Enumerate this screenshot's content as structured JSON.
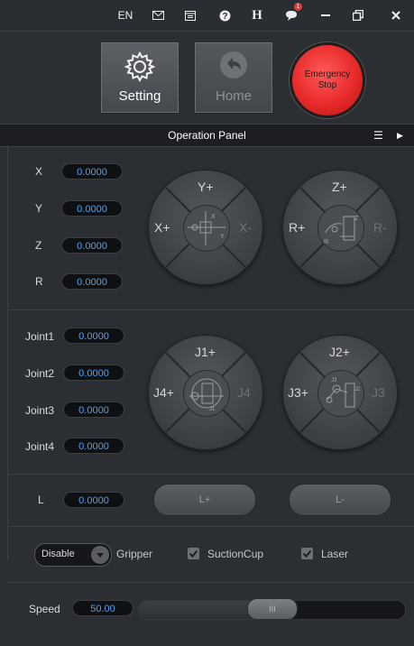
{
  "topbar": {
    "language": "EN",
    "icons": [
      "mail-icon",
      "calendar-icon",
      "help-icon",
      "h-icon",
      "notification-icon",
      "minimize-icon",
      "restore-icon",
      "close-icon"
    ],
    "notification_count": "1",
    "h_label": "H"
  },
  "actions": {
    "setting_label": "Setting",
    "home_label": "Home",
    "emergency_line1": "Emergency",
    "emergency_line2": "Stop",
    "emergency_color": "#e82a2a"
  },
  "panel": {
    "title": "Operation Panel"
  },
  "cartesian": [
    {
      "label": "X",
      "value": "0.0000"
    },
    {
      "label": "Y",
      "value": "0.0000"
    },
    {
      "label": "Z",
      "value": "0.0000"
    },
    {
      "label": "R",
      "value": "0.0000"
    }
  ],
  "joints": [
    {
      "label": "Joint1",
      "value": "0.0000"
    },
    {
      "label": "Joint2",
      "value": "0.0000"
    },
    {
      "label": "Joint3",
      "value": "0.0000"
    },
    {
      "label": "Joint4",
      "value": "0.0000"
    }
  ],
  "pads": {
    "xy": {
      "top": "Y+",
      "left": "X+",
      "right": "X-",
      "bottom": ""
    },
    "zr": {
      "top": "Z+",
      "left": "R+",
      "right": "R-",
      "bottom": ""
    },
    "j1j4": {
      "top": "J1+",
      "left": "J4+",
      "right": "J4",
      "bottom": ""
    },
    "j2j3": {
      "top": "J2+",
      "left": "J3+",
      "right": "J3",
      "bottom": ""
    }
  },
  "linear": {
    "label": "L",
    "value": "0.0000",
    "plus_label": "L+",
    "minus_label": "L-"
  },
  "end_effector": {
    "mode_selected": "Disable",
    "gripper_label": "Gripper",
    "suction_label": "SuctionCup",
    "laser_label": "Laser"
  },
  "speed": {
    "label": "Speed",
    "value": "50.00",
    "fraction": 0.5,
    "thumb_label": "III"
  },
  "colors": {
    "value_text": "#49a4ff",
    "background": "#2b2e33"
  }
}
